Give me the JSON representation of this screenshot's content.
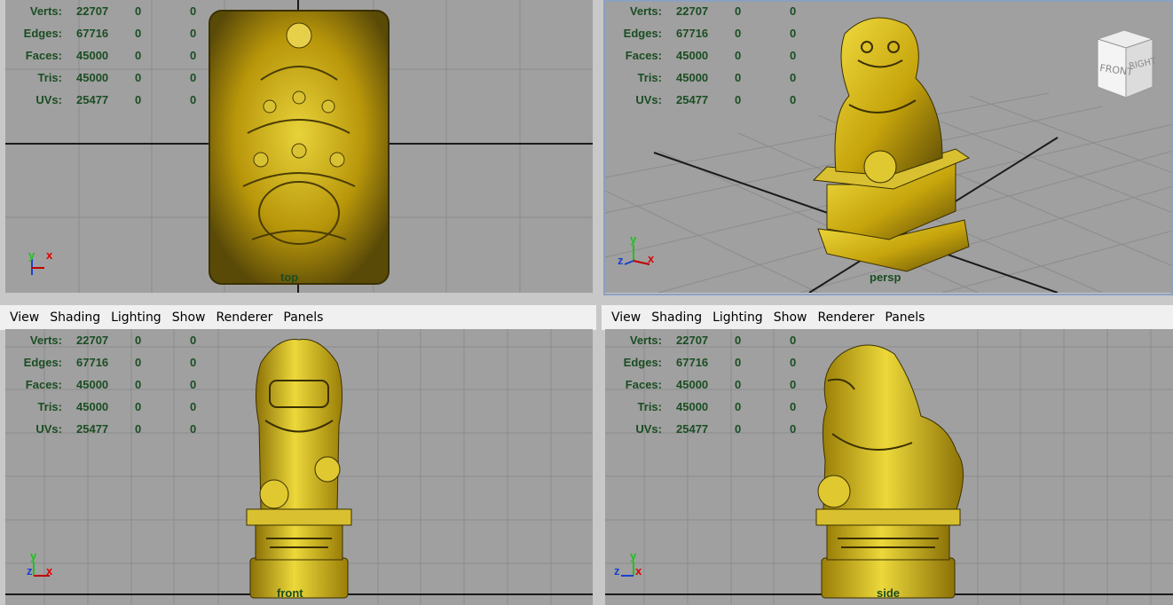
{
  "menu": [
    "View",
    "Shading",
    "Lighting",
    "Show",
    "Renderer",
    "Panels"
  ],
  "stats": [
    {
      "label": "Verts:",
      "value": "22707",
      "sel": "0",
      "tri": "0"
    },
    {
      "label": "Edges:",
      "value": "67716",
      "sel": "0",
      "tri": "0"
    },
    {
      "label": "Faces:",
      "value": "45000",
      "sel": "0",
      "tri": "0"
    },
    {
      "label": "Tris:",
      "value": "45000",
      "sel": "0",
      "tri": "0"
    },
    {
      "label": "UVs:",
      "value": "25477",
      "sel": "0",
      "tri": "0"
    }
  ],
  "viewports": {
    "top": {
      "camera": "top",
      "axis": [
        "y",
        "x"
      ]
    },
    "persp": {
      "camera": "persp",
      "axis": [
        "y",
        "z",
        "x"
      ]
    },
    "front": {
      "camera": "front",
      "axis": [
        "y",
        "z",
        "x"
      ]
    },
    "side": {
      "camera": "side",
      "axis": [
        "y",
        "z",
        "x"
      ]
    }
  },
  "viewcube": {
    "front": "FRONT",
    "right": "RIGHT"
  },
  "colors": {
    "viewport_bg": "#a0a0a0",
    "grid": "#8a8a8a",
    "axis_line": "#1a1a1a",
    "hud_text": "#1a4d22",
    "model_gold": "#c9a80a"
  }
}
